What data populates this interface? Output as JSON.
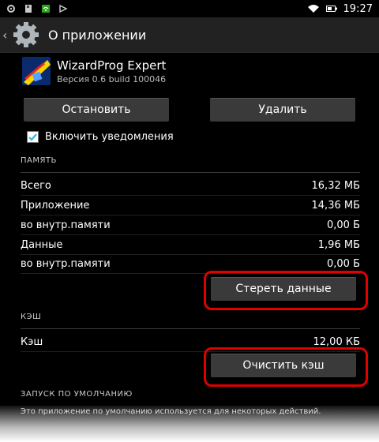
{
  "status_bar": {
    "time": "19:27",
    "icons": [
      "settings-icon",
      "sd-card-icon",
      "wifi-alert-icon",
      "signal-off-icon",
      "wifi-icon",
      "battery-icon"
    ]
  },
  "action_bar": {
    "title": "О приложении"
  },
  "app": {
    "name": "WizardProg Expert",
    "version": "Версия 0.6 build 100046",
    "logo_text": "WP"
  },
  "buttons": {
    "stop": "Остановить",
    "uninstall": "Удалить",
    "clear_data": "Стереть данные",
    "clear_cache": "Очистить кэш"
  },
  "notifications": {
    "label": "Включить уведомления",
    "checked": true
  },
  "storage": {
    "header": "ПАМЯТЬ",
    "rows": [
      {
        "label": "Всего",
        "value": "16,32 МБ"
      },
      {
        "label": "Приложение",
        "value": "14,36 МБ"
      },
      {
        "label": "во внутр.памяти",
        "value": "0,00 Б"
      },
      {
        "label": "Данные",
        "value": "1,96 МБ"
      },
      {
        "label": "во внутр.памяти",
        "value": "0,00 Б"
      }
    ]
  },
  "cache": {
    "header": "КЭШ",
    "label": "Кэш",
    "value": "12,00 КБ"
  },
  "launch": {
    "header": "ЗАПУСК ПО УМОЛЧАНИЮ",
    "text": "Это приложение по умолчанию используется для некоторых действий."
  },
  "colors": {
    "highlight": "#e00000",
    "accent": "#33b5e5"
  }
}
